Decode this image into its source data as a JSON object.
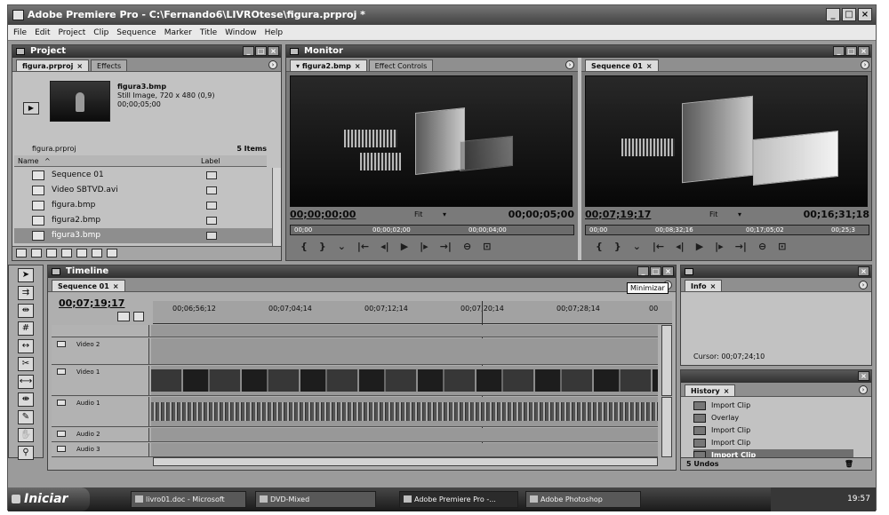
{
  "window": {
    "title": "Adobe Premiere Pro - C:\\Fernando6\\LIVROtese\\figura.prproj *"
  },
  "menu": [
    "File",
    "Edit",
    "Project",
    "Clip",
    "Sequence",
    "Marker",
    "Title",
    "Window",
    "Help"
  ],
  "project": {
    "title": "Project",
    "tabs": [
      "figura.prproj",
      "Effects"
    ],
    "preview": {
      "filename": "figura3.bmp",
      "type": "Still Image, 720 x 480 (0,9)",
      "duration": "00;00;05;00"
    },
    "bin_name": "figura.prproj",
    "item_count": "5 Items",
    "columns": {
      "name": "Name",
      "label": "Label"
    },
    "items": [
      "Sequence 01",
      "Video SBTVD.avi",
      "figura.bmp",
      "figura2.bmp",
      "figura3.bmp"
    ]
  },
  "monitor": {
    "title": "Monitor",
    "source": {
      "tabs": [
        "figura2.bmp",
        "Effect Controls"
      ],
      "timecode": "00;00;00;00",
      "fit": "Fit",
      "duration": "00;00;05;00",
      "ruler": [
        "00;00",
        "00;00;02;00",
        "00;00;04;00"
      ]
    },
    "program": {
      "tab": "Sequence 01",
      "timecode": "00;07;19;17",
      "fit": "Fit",
      "duration": "00;16;31;18",
      "ruler": [
        "00;00",
        "00;08;32;16",
        "00;17;05;02",
        "00;25;3"
      ]
    }
  },
  "timeline": {
    "title": "Timeline",
    "tab": "Sequence 01",
    "timecode": "00;07;19;17",
    "ruler": [
      "00;06;56;12",
      "00;07;04;14",
      "00;07;12;14",
      "00;07;20;14",
      "00;07;28;14",
      "00"
    ],
    "tracks": [
      "Video 2",
      "Video 1",
      "Audio 1",
      "Audio 2",
      "Audio 3"
    ],
    "tooltip": "Minimizar"
  },
  "info": {
    "tab": "Info",
    "cursor": "Cursor: 00;07;24;10"
  },
  "history": {
    "tab": "History",
    "items": [
      "Import Clip",
      "Overlay",
      "Import Clip",
      "Import Clip",
      "Import Clip"
    ],
    "footer": "5 Undos"
  },
  "taskbar": {
    "start": "Iniciar",
    "items": [
      "livro01.doc - Microsoft",
      "DVD-Mixed",
      "Adobe Premiere Pro -...",
      "Adobe Photoshop"
    ],
    "clock": "19:57"
  }
}
